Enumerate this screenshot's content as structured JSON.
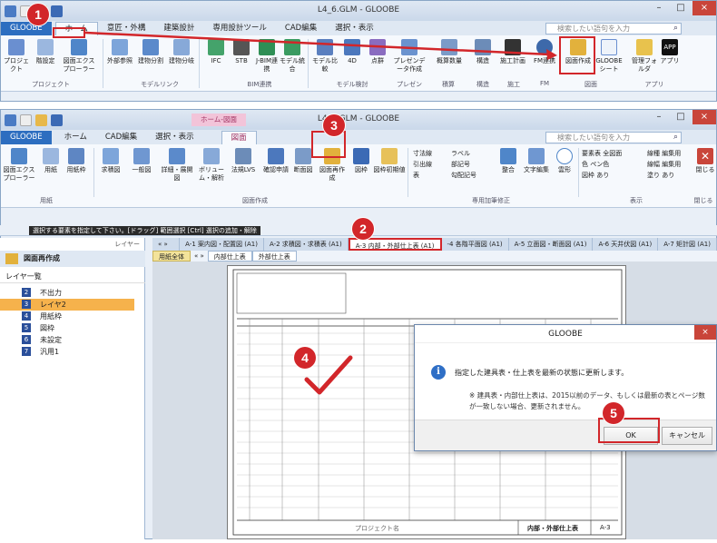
{
  "window1": {
    "title": "L4_6.GLM - GLOOBE",
    "tabs": [
      "GLOOBE",
      "ホーム",
      "意匠・外構",
      "建築設計",
      "専用設計ツール",
      "CAD編集",
      "選択・表示"
    ],
    "search_placeholder": "検索したい語句を入力",
    "ribbon_buttons": [
      "プロジェクト",
      "階設定",
      "図面エクスプローラー",
      "外部参照",
      "建物分割",
      "建物分岐",
      "IFC",
      "STB",
      "J-BIM連携",
      "モデル統合",
      "モデル比較",
      "4D",
      "点群",
      "プレゼンデータ作成",
      "概算数量",
      "構造",
      "施工計画",
      "FM連携",
      "図面作成",
      "GLOOBEシート",
      "管理フォルダ",
      "アプリ"
    ],
    "app_label": "APP",
    "groups": [
      "プロジェクト",
      "モデルリンク",
      "BIM連携",
      "モデル検討",
      "プレゼン",
      "積算",
      "構造",
      "施工",
      "FM",
      "図面",
      "アプリ"
    ]
  },
  "window2": {
    "title": "L4_6.GLM - GLOOBE",
    "context_tab": "ホーム-図面",
    "tabs": [
      "GLOOBE",
      "ホーム",
      "CAD編集",
      "選択・表示",
      "図面"
    ],
    "search_placeholder": "検索したい語句を入力",
    "ribbon_buttons": [
      "図面エクスプローラー",
      "用紙",
      "用紙枠",
      "求積図",
      "一般図",
      "詳細・展開図",
      "ボリューム・解析",
      "法規LVS",
      "確認申請",
      "断面図",
      "図面再作成",
      "図枠",
      "図枠初期値"
    ],
    "ribbon_small": [
      "寸法線",
      "ラベル",
      "引出線",
      "部記号",
      "表",
      "勾配記号",
      "整合",
      "文字編集",
      "雲形"
    ],
    "display_fields": [
      {
        "label": "要素表",
        "value": "全図面"
      },
      {
        "label": "色",
        "value": "ペン色"
      },
      {
        "label": "図枠",
        "value": "あり"
      }
    ],
    "display_fields2": [
      {
        "label": "線種",
        "value": "編集用"
      },
      {
        "label": "線幅",
        "value": "編集用"
      },
      {
        "label": "塗り",
        "value": "あり"
      }
    ],
    "groups": [
      "用紙",
      "図面作成",
      "専用加筆修正",
      "表示",
      "閉じる"
    ],
    "close_label": "閉じる",
    "status_hint": "選択する要素を指定して下さい。[ドラッグ] 範囲選択 [Ctrl] 選択の追加・解除",
    "layer_toolbar": "レイヤー",
    "doc_tabs": [
      "A-1 案内図・配置図 (A1)",
      "A-2 求積図・求積表 (A1)",
      "A-3 内部・外部仕上表 (A1)",
      "-4 各階平面図 (A1)",
      "A-5 立面図・断面図 (A1)",
      "A-6 天井伏図 (A1)",
      "A-7 矩計図 (A1)"
    ],
    "sub_tabs": [
      "用紙全体",
      "内部仕上表",
      "外部仕上表"
    ],
    "panel_title": "図面再作成",
    "layer_header": "レイヤ一覧",
    "layers": [
      {
        "num": "2",
        "name": "不出力"
      },
      {
        "num": "3",
        "name": "レイヤ2"
      },
      {
        "num": "4",
        "name": "用紙枠"
      },
      {
        "num": "5",
        "name": "図枠"
      },
      {
        "num": "6",
        "name": "未設定"
      },
      {
        "num": "7",
        "name": "汎用1"
      }
    ],
    "sheet_footer": "内部・外部仕上表",
    "sheet_footer_code": "A-3",
    "sheet_footer_project": "プロジェクト名"
  },
  "dialog": {
    "title": "GLOOBE",
    "close": "×",
    "message": "指定した建具表・仕上表を最新の状態に更新します。",
    "note": "※ 建具表・内部仕上表は、2015以前のデータ、もしくは最新の表とページ数が一致しない場合、更新されません。",
    "ok": "OK",
    "cancel": "キャンセル"
  },
  "steps": [
    "1",
    "2",
    "3",
    "4",
    "5"
  ],
  "colors": {
    "accent": "#d2262a",
    "file_tab": "#2d6ec0",
    "selected_layer": "#f6b24c"
  }
}
